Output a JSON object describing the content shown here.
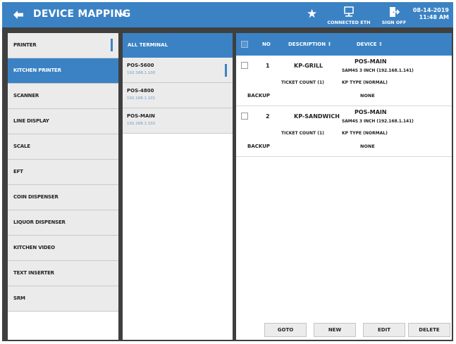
{
  "header": {
    "title": "DEVICE MAPPING",
    "connection_label": "CONNECTED ETH",
    "signoff_label": "SIGN OFF",
    "date": "08-14-2019",
    "time": "11:48 AM"
  },
  "categories": [
    {
      "label": "PRINTER",
      "marked": true
    },
    {
      "label": "KITCHEN PRINTER",
      "selected": true
    },
    {
      "label": "SCANNER"
    },
    {
      "label": "LINE DISPLAY"
    },
    {
      "label": "SCALE"
    },
    {
      "label": "EFT"
    },
    {
      "label": "COIN DISPENSER"
    },
    {
      "label": "LIQUOR DISPENSER"
    },
    {
      "label": "KITCHEN VIDEO"
    },
    {
      "label": "TEXT INSERTER"
    },
    {
      "label": "SRM"
    }
  ],
  "terminals": {
    "header": "ALL TERMINAL",
    "items": [
      {
        "name": "POS-5600",
        "ip": "192.168.1.100",
        "marked": true
      },
      {
        "name": "POS-4800",
        "ip": "192.168.1.101"
      },
      {
        "name": "POS-MAIN",
        "ip": "192.168.1.102"
      }
    ]
  },
  "grid": {
    "columns": {
      "no": "NO",
      "description": "DESCRIPTION ↕",
      "device": "DEVICE ↕"
    },
    "rows": [
      {
        "no": "1",
        "description": "KP-GRILL",
        "device_name": "POS-MAIN",
        "device_detail": "SAM4S 3 INCH (192.168.1.141)",
        "ticket_count": "TICKET COUNT (1)",
        "kp_type": "KP TYPE (NORMAL)",
        "backup_label": "BACKUP",
        "backup_value": "NONE"
      },
      {
        "no": "2",
        "description": "KP-SANDWICH",
        "device_name": "POS-MAIN",
        "device_detail": "SAM4S 3 INCH (192.168.1.141)",
        "ticket_count": "TICKET COUNT (1)",
        "kp_type": "KP TYPE (NORMAL)",
        "backup_label": "BACKUP",
        "backup_value": "NONE"
      }
    ]
  },
  "actions": {
    "goto": "GOTO",
    "new": "NEW",
    "edit": "EDIT",
    "delete": "DELETE"
  },
  "colors": {
    "accent": "#3b82c4",
    "list_bg": "#ebebeb",
    "frame": "#3f3f3f"
  }
}
